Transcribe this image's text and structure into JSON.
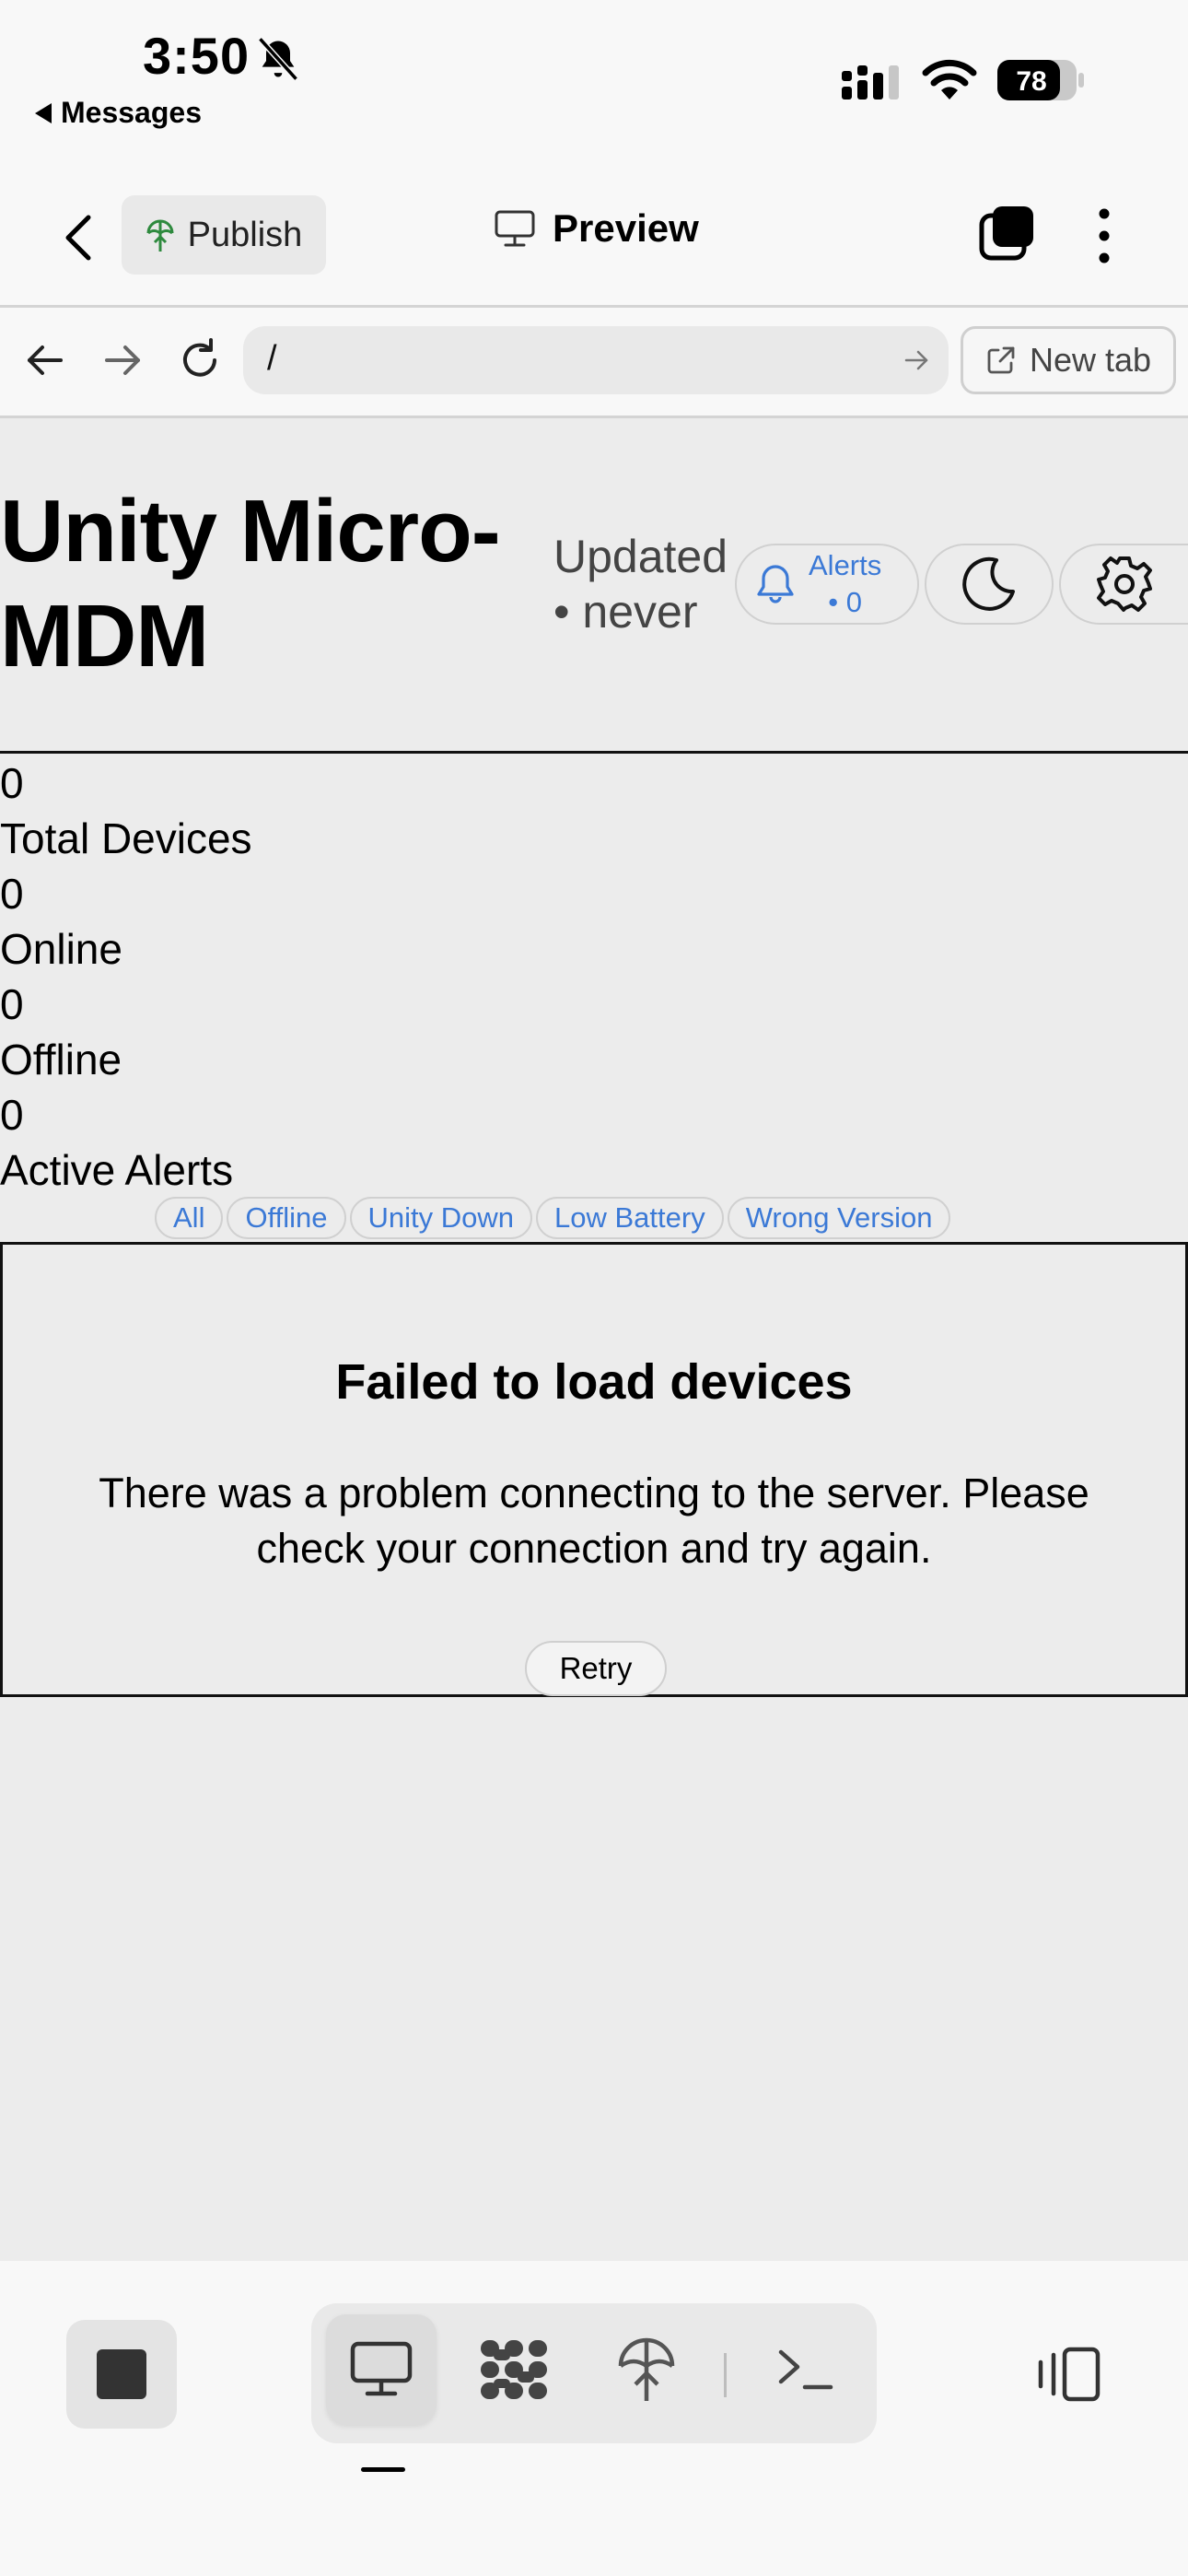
{
  "status_bar": {
    "time": "3:50",
    "back_app": "Messages",
    "battery": "78"
  },
  "app_bar": {
    "publish_label": "Publish",
    "preview_label": "Preview"
  },
  "browser": {
    "url": "/",
    "new_tab_label": "New tab"
  },
  "page": {
    "title": "Unity Micro-MDM",
    "updated_text": "Updated • never",
    "alerts_label": "Alerts",
    "alerts_count": "• 0",
    "stats": [
      {
        "value": "0",
        "label": "Total Devices"
      },
      {
        "value": "0",
        "label": "Online"
      },
      {
        "value": "0",
        "label": "Offline"
      },
      {
        "value": "0",
        "label": "Active Alerts"
      }
    ],
    "filters": [
      "All",
      "Offline",
      "Unity Down",
      "Low Battery",
      "Wrong Version"
    ],
    "error": {
      "title": "Failed to load devices",
      "message": "There was a problem connecting to the server. Please check your connection and try again.",
      "retry_label": "Retry"
    }
  },
  "colors": {
    "accent": "#3b79d6",
    "page_bg": "#ececec",
    "chrome_bg": "#f8f8f8"
  },
  "icons": [
    "bell-slash-icon",
    "signal-icon",
    "wifi-icon",
    "battery-icon",
    "chevron-left-icon",
    "publish-icon",
    "monitor-icon",
    "tabs-icon",
    "more-icon",
    "arrow-left-icon",
    "arrow-right-icon",
    "reload-icon",
    "external-link-icon",
    "bell-icon",
    "moon-icon",
    "gear-icon",
    "stop-icon",
    "preview-tool-icon",
    "packages-icon",
    "deploy-icon",
    "terminal-icon",
    "split-view-icon"
  ]
}
